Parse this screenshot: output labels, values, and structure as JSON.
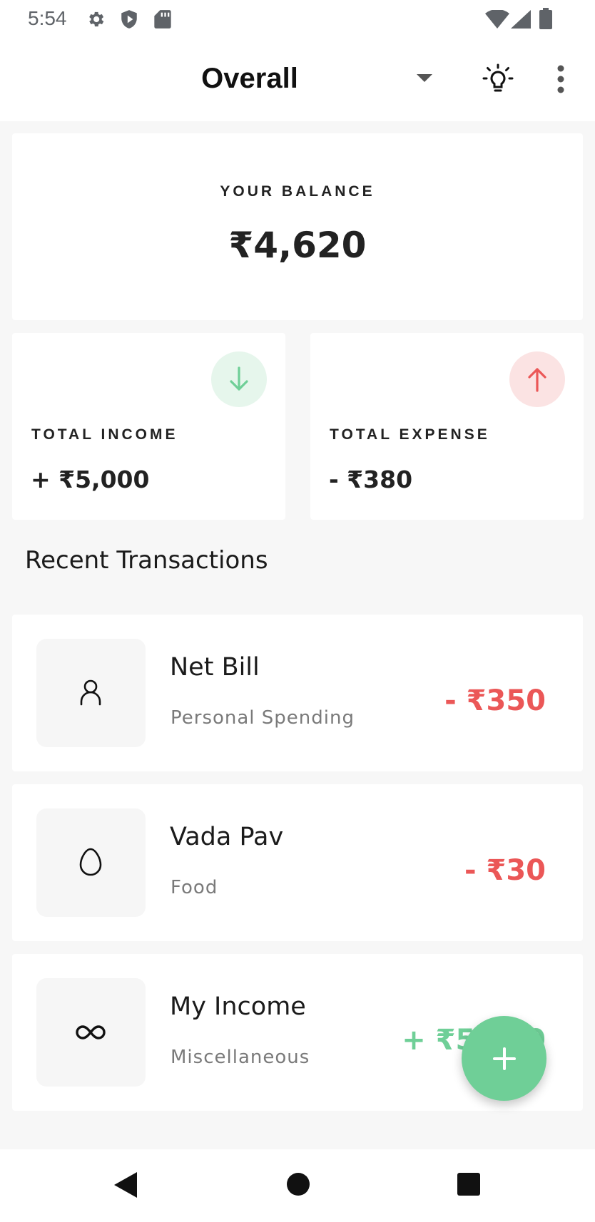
{
  "status_bar": {
    "time": "5:54",
    "icons": [
      "gear-icon",
      "shield-icon",
      "sd-card-icon",
      "wifi-icon",
      "signal-icon",
      "battery-icon"
    ]
  },
  "app_bar": {
    "title": "Overall",
    "icons": [
      "dropdown-arrow-icon",
      "lightbulb-icon",
      "more-vert-icon"
    ]
  },
  "balance": {
    "label": "YOUR BALANCE",
    "value": "₹4,620"
  },
  "income": {
    "label": "TOTAL INCOME",
    "value": "+ ₹5,000",
    "icon": "arrow-down-icon",
    "color": "#6fcf97",
    "bg": "#e6f6ec"
  },
  "expense": {
    "label": "TOTAL EXPENSE",
    "value": "- ₹380",
    "icon": "arrow-up-icon",
    "color": "#eb5757",
    "bg": "#fbe3e3"
  },
  "section_title": "Recent Transactions",
  "transactions": [
    {
      "title": "Net Bill",
      "category": "Personal Spending",
      "amount": "- ₹350",
      "icon": "person-icon",
      "color": "#eb5757"
    },
    {
      "title": "Vada Pav",
      "category": "Food",
      "amount": "- ₹30",
      "icon": "egg-icon",
      "color": "#eb5757"
    },
    {
      "title": "My Income",
      "category": "Miscellaneous",
      "amount": "+ ₹5,000",
      "icon": "infinity-icon",
      "color": "#6fcf97"
    }
  ],
  "fab": {
    "icon": "plus-icon",
    "color": "#6fcf97"
  },
  "nav_bar": {
    "icons": [
      "back-icon",
      "home-icon",
      "recents-icon"
    ]
  }
}
